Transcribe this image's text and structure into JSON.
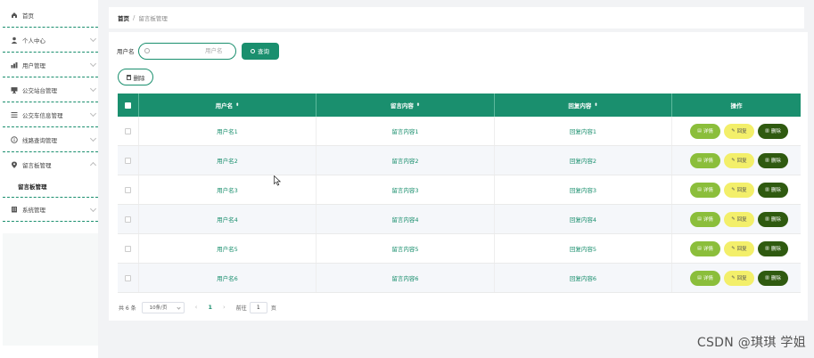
{
  "sidebar": {
    "items": [
      {
        "label": "首页",
        "icon": "home-icon"
      },
      {
        "label": "个人中心",
        "icon": "user-icon"
      },
      {
        "label": "用户管理",
        "icon": "users-icon"
      },
      {
        "label": "公交站台管理",
        "icon": "monitor-icon"
      },
      {
        "label": "公交车信息管理",
        "icon": "list-icon"
      },
      {
        "label": "线路查询管理",
        "icon": "info-icon"
      },
      {
        "label": "留言板管理",
        "icon": "location-icon"
      },
      {
        "label": "系统管理",
        "icon": "building-icon"
      }
    ],
    "sub_item": "留言板管理"
  },
  "breadcrumb": {
    "home": "首页",
    "separator": "/",
    "current": "留言板管理"
  },
  "search": {
    "label": "用户名",
    "placeholder": "用户名",
    "button": "查询"
  },
  "toolbar": {
    "delete_label": "删除"
  },
  "table": {
    "headers": {
      "username": "用户名",
      "message": "留言内容",
      "reply": "回复内容",
      "actions": "操作"
    },
    "rows": [
      {
        "username": "用户名1",
        "message": "留言内容1",
        "reply": "回复内容1"
      },
      {
        "username": "用户名2",
        "message": "留言内容2",
        "reply": "回复内容2"
      },
      {
        "username": "用户名3",
        "message": "留言内容3",
        "reply": "回复内容3"
      },
      {
        "username": "用户名4",
        "message": "留言内容4",
        "reply": "回复内容4"
      },
      {
        "username": "用户名5",
        "message": "留言内容5",
        "reply": "回复内容5"
      },
      {
        "username": "用户名6",
        "message": "留言内容6",
        "reply": "回复内容6"
      }
    ],
    "actions": {
      "detail": "详情",
      "reply": "回复",
      "delete": "删除"
    }
  },
  "pagination": {
    "total": "共 6 条",
    "page_size": "10条/页",
    "prev": "‹",
    "current_page": "1",
    "next": "›",
    "goto": "前往",
    "goto_value": "1",
    "unit": "页"
  },
  "watermark": "CSDN @琪琪 学姐",
  "colors": {
    "primary": "#1a8f6e",
    "detail": "#8bbe3b",
    "reply": "#f3ef6a",
    "delete": "#2f5a10"
  }
}
